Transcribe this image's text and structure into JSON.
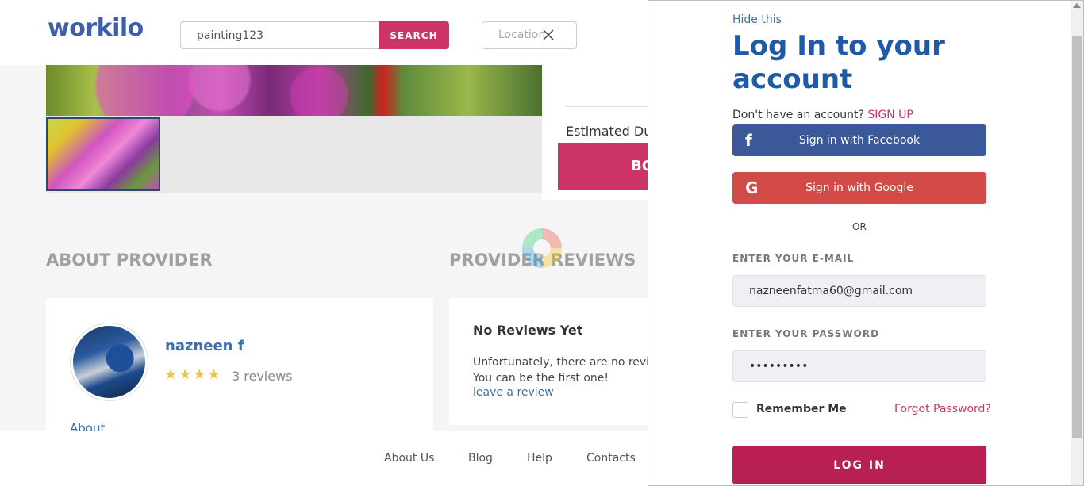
{
  "header": {
    "logo": "workilo",
    "search_value": "painting123",
    "search_button": "SEARCH",
    "location_placeholder": "Location"
  },
  "booking": {
    "estimated_duration": "Estimated Dur",
    "book_button": "BO"
  },
  "sections": {
    "about_title": "ABOUT PROVIDER",
    "reviews_title": "PROVIDER REVIEWS"
  },
  "provider": {
    "name": "nazneen f",
    "stars": "★★★★",
    "reviews": "3 reviews",
    "about_link": "About"
  },
  "reviews": {
    "heading": "No Reviews Yet",
    "line1": "Unfortunately, there are no review",
    "line2": "You can be the first one!",
    "leave_link": "leave a review"
  },
  "footer": {
    "links": [
      "About Us",
      "Blog",
      "Help",
      "Contacts"
    ]
  },
  "login": {
    "hide": "Hide this",
    "title": "Log In to your account",
    "signup_prompt": "Don't have an account?",
    "signup_link": "SIGN UP",
    "facebook": "Sign in with Facebook",
    "google": "Sign in with Google",
    "or": "OR",
    "email_label": "ENTER YOUR E-MAIL",
    "email_value": "nazneenfatma60@gmail.com",
    "password_label": "ENTER YOUR PASSWORD",
    "password_value": "•••••••••",
    "remember": "Remember Me",
    "forgot": "Forgot Password?",
    "login_button": "LOG IN"
  },
  "colors": {
    "brand": "#3d5fa8",
    "accent": "#cc3366",
    "facebook": "#3b5998",
    "google": "#d34b47",
    "login_button": "#b81f52"
  },
  "icons": {
    "facebook": "f",
    "google": "G"
  }
}
